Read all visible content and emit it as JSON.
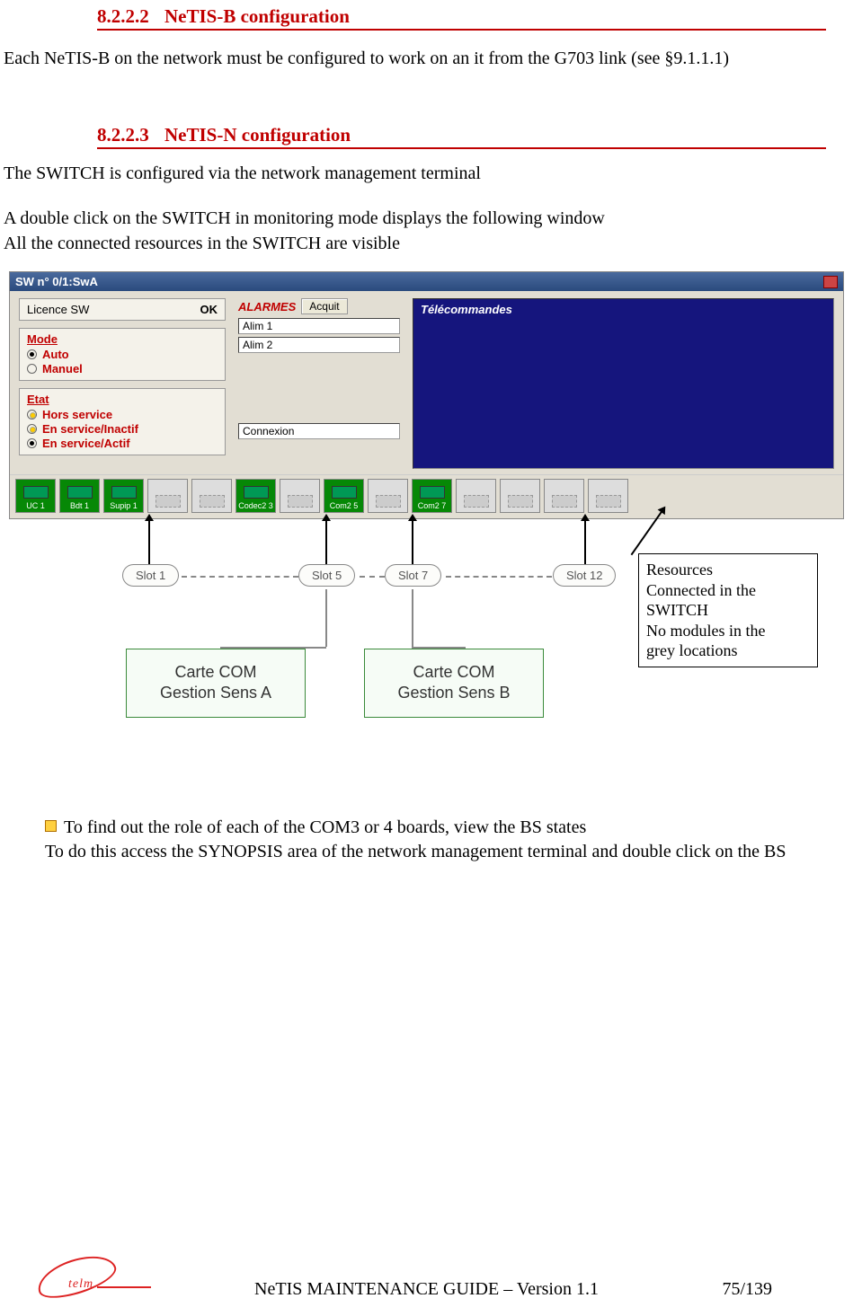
{
  "headings": {
    "h1_num": "8.2.2.2",
    "h1_title": "NeTIS-B configuration",
    "h2_num": "8.2.2.3",
    "h2_title": "NeTIS-N configuration"
  },
  "paragraphs": {
    "p1": "Each NeTIS-B on the network must be configured to work on an it from the G703 link (see §9.1.1.1)",
    "p2": "The SWITCH is configured via the network management terminal",
    "p3": "A double click on the SWITCH in monitoring mode displays the following window",
    "p4": "All the connected resources in the SWITCH are visible"
  },
  "window": {
    "title": "SW n° 0/1:SwA",
    "licence_label": "Licence SW",
    "licence_value": "OK",
    "mode": {
      "title": "Mode",
      "opt1": "Auto",
      "opt2": "Manuel"
    },
    "etat": {
      "title": "Etat",
      "opt1": "Hors service",
      "opt2": "En service/Inactif",
      "opt3": "En service/Actif"
    },
    "alarmes_label": "ALARMES",
    "acquit_btn": "Acquit",
    "alim1": "Alim 1",
    "alim2": "Alim 2",
    "connexion": "Connexion",
    "telecommandes": "Télécommandes",
    "slots": [
      {
        "label": "UC 1",
        "active": true
      },
      {
        "label": "Bdt 1",
        "active": true
      },
      {
        "label": "Supip 1",
        "active": true
      },
      {
        "label": "",
        "active": false
      },
      {
        "label": "",
        "active": false
      },
      {
        "label": "Codec2 3",
        "active": true
      },
      {
        "label": "",
        "active": false
      },
      {
        "label": "Com2 5",
        "active": true
      },
      {
        "label": "",
        "active": false
      },
      {
        "label": "Com2 7",
        "active": true
      },
      {
        "label": "",
        "active": false
      },
      {
        "label": "",
        "active": false
      },
      {
        "label": "",
        "active": false
      },
      {
        "label": "",
        "active": false
      }
    ]
  },
  "annotations": {
    "slot1": "Slot 1",
    "slot5": "Slot 5",
    "slot7": "Slot 7",
    "slot12": "Slot 12",
    "boxA_l1": "Carte COM",
    "boxA_l2": "Gestion Sens A",
    "boxB_l1": "Carte COM",
    "boxB_l2": "Gestion Sens B",
    "resources_l1": "Resources",
    "resources_l2": "Connected in the",
    "resources_l3": "SWITCH",
    "resources_l4": "No modules in the",
    "resources_l5": "grey locations"
  },
  "bullet": {
    "line1": "To find out the role of each of the COM3 or 4 boards, view the BS states",
    "line2": "To do this access the SYNOPSIS area of the network management terminal and double click on the BS"
  },
  "footer": {
    "logo_text": "telm",
    "center": "NeTIS MAINTENANCE GUIDE – Version 1.1",
    "pages": "75/139"
  }
}
